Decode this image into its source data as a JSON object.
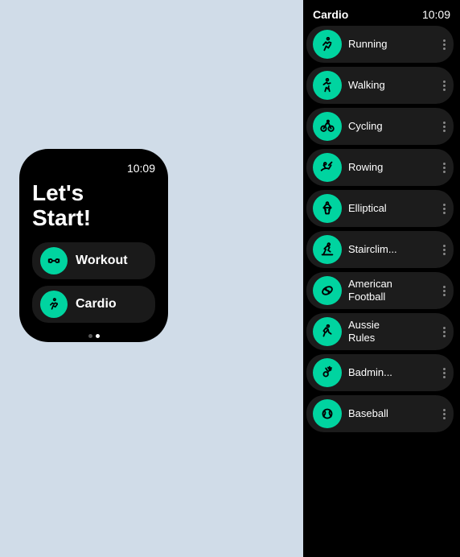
{
  "background": "#d0dce8",
  "leftWatch": {
    "time": "10:09",
    "title": "Let's\nStart!",
    "menuItems": [
      {
        "id": "workout",
        "label": "Workout",
        "icon": "dumbbell"
      },
      {
        "id": "cardio",
        "label": "Cardio",
        "icon": "running"
      }
    ],
    "dots": [
      "inactive",
      "active"
    ]
  },
  "rightWatch": {
    "header": "Cardio",
    "time": "10:09",
    "items": [
      {
        "id": "running",
        "label": "Running",
        "icon": "running"
      },
      {
        "id": "walking",
        "label": "Walking",
        "icon": "walking"
      },
      {
        "id": "cycling",
        "label": "Cycling",
        "icon": "cycling"
      },
      {
        "id": "rowing",
        "label": "Rowing",
        "icon": "rowing"
      },
      {
        "id": "elliptical",
        "label": "Elliptical",
        "icon": "elliptical"
      },
      {
        "id": "stairclimber",
        "label": "Stairclim...",
        "icon": "stairs"
      },
      {
        "id": "americanfootball",
        "label": "American\nFootball",
        "icon": "football"
      },
      {
        "id": "aussierules",
        "label": "Aussie\nRules",
        "icon": "aussie"
      },
      {
        "id": "badminton",
        "label": "Badmin...",
        "icon": "badminton"
      },
      {
        "id": "baseball",
        "label": "Baseball",
        "icon": "baseball"
      }
    ]
  }
}
